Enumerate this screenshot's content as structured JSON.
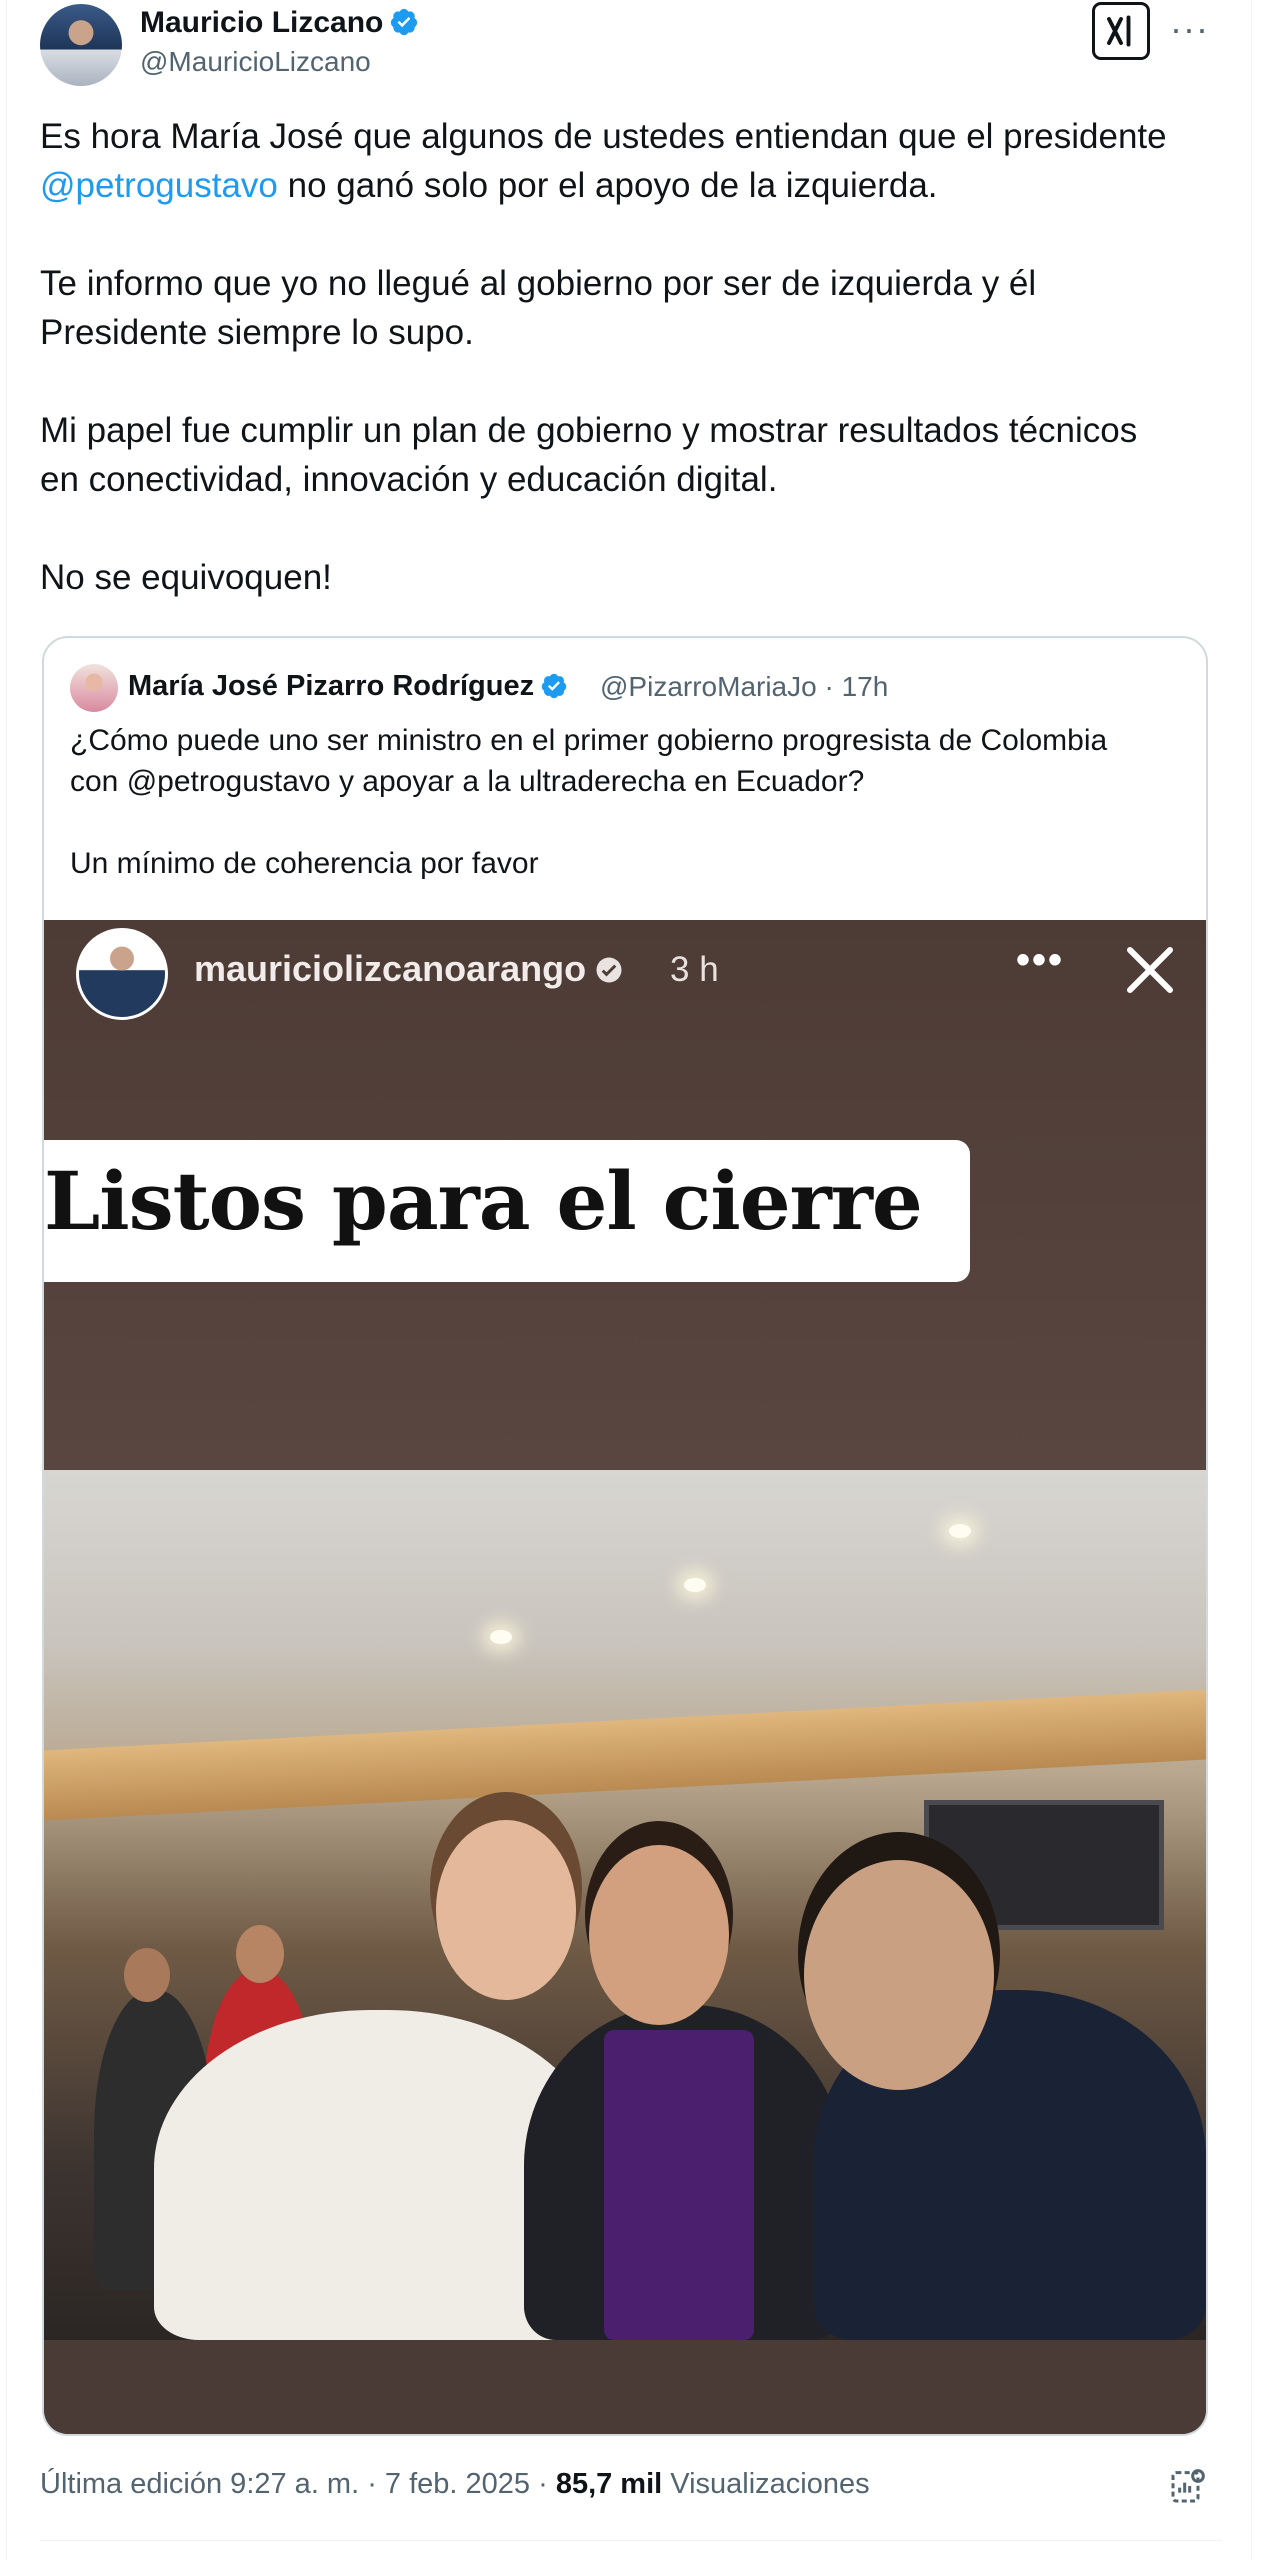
{
  "author": {
    "name": "Mauricio Lizcano",
    "handle": "@MauricioLizcano"
  },
  "header_actions": {
    "grok_icon": "grok-icon",
    "more_label": "···"
  },
  "tweet": {
    "p1_before": "Es hora María José que algunos de ustedes entiendan que el presidente",
    "p1_mention": "@petrogustavo",
    "p1_after": " no ganó solo por el apoyo de la izquierda.",
    "p2": "Te informo que yo no llegué al gobierno por ser de izquierda y él\nPresidente siempre lo supo.",
    "p3": "Mi papel fue cumplir un plan de gobierno y mostrar resultados técnicos\nen conectividad, innovación y educación digital.",
    "p4": "No se equivoquen!"
  },
  "quote": {
    "name": "María José Pizarro Rodríguez",
    "meta": "@PizarroMariaJo · 17h",
    "text": "¿Cómo puede uno ser ministro en el primer gobierno progresista de Colombia\ncon @petrogustavo y apoyar a la ultraderecha en Ecuador?\n\nUn mínimo de coherencia por favor"
  },
  "story": {
    "username": "mauriciolizcanoarango",
    "time": "3 h",
    "dots": "•••",
    "banner": "Listos para el cierre"
  },
  "footer": {
    "edited": "Última edición 9:27 a. m. · 7 feb. 2025 · ",
    "views_count": "85,7 mil",
    "views_label": " Visualizaciones"
  },
  "colors": {
    "accent": "#1d9bf0",
    "text": "#0f1419",
    "secondary": "#536471"
  }
}
